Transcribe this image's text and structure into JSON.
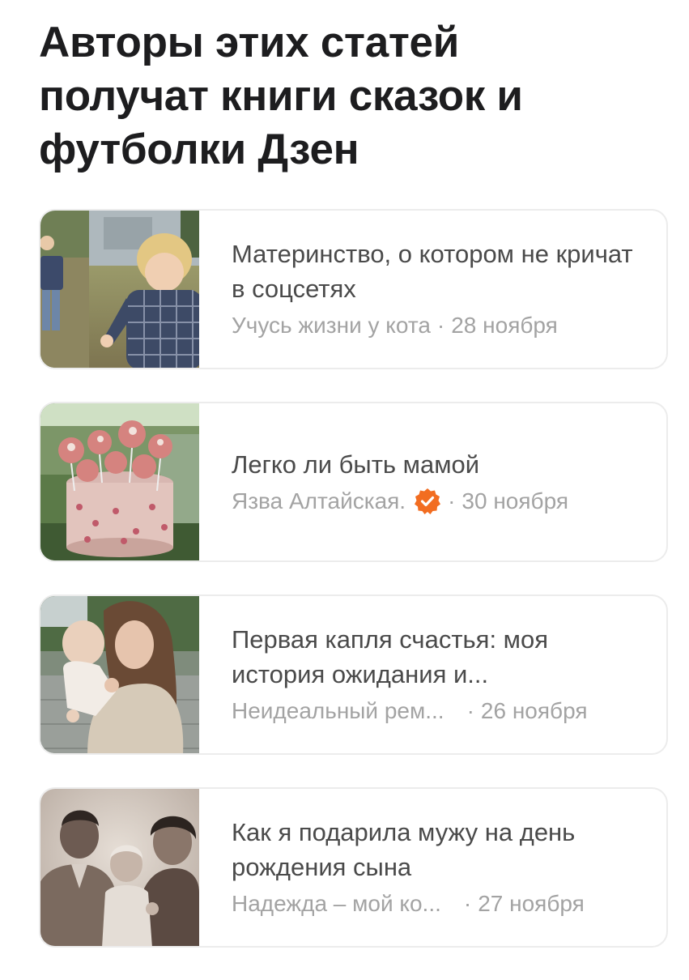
{
  "heading": "Авторы этих статей получат книги сказок и футболки Дзен",
  "articles": [
    {
      "title": "Материнство, о котором не кричат в соцсетях",
      "author": "Учусь жизни у кота",
      "separator": "·",
      "date": "28 ноября",
      "verified": false,
      "image_icon": "toddler-photo"
    },
    {
      "title": "Легко ли быть мамой",
      "author": "Язва Алтайская.",
      "separator": "·",
      "date": "30 ноября",
      "verified": true,
      "image_icon": "cake-photo"
    },
    {
      "title": "Первая капля счастья: моя история ожидания и...",
      "author": "Неидеальный рем...",
      "separator": "·",
      "date": "26 ноября",
      "verified": false,
      "image_icon": "mother-baby-photo"
    },
    {
      "title": "Как я подарила мужу на день рождения сына",
      "author": "Надежда – мой ко...",
      "separator": "·",
      "date": "27 ноября",
      "verified": false,
      "image_icon": "vintage-family-photo"
    }
  ],
  "colors": {
    "verified_badge": "#f26d21",
    "heading": "#1d1d1f",
    "title": "#4a4a4a",
    "meta": "#a3a3a3",
    "card_border": "#ececec"
  }
}
